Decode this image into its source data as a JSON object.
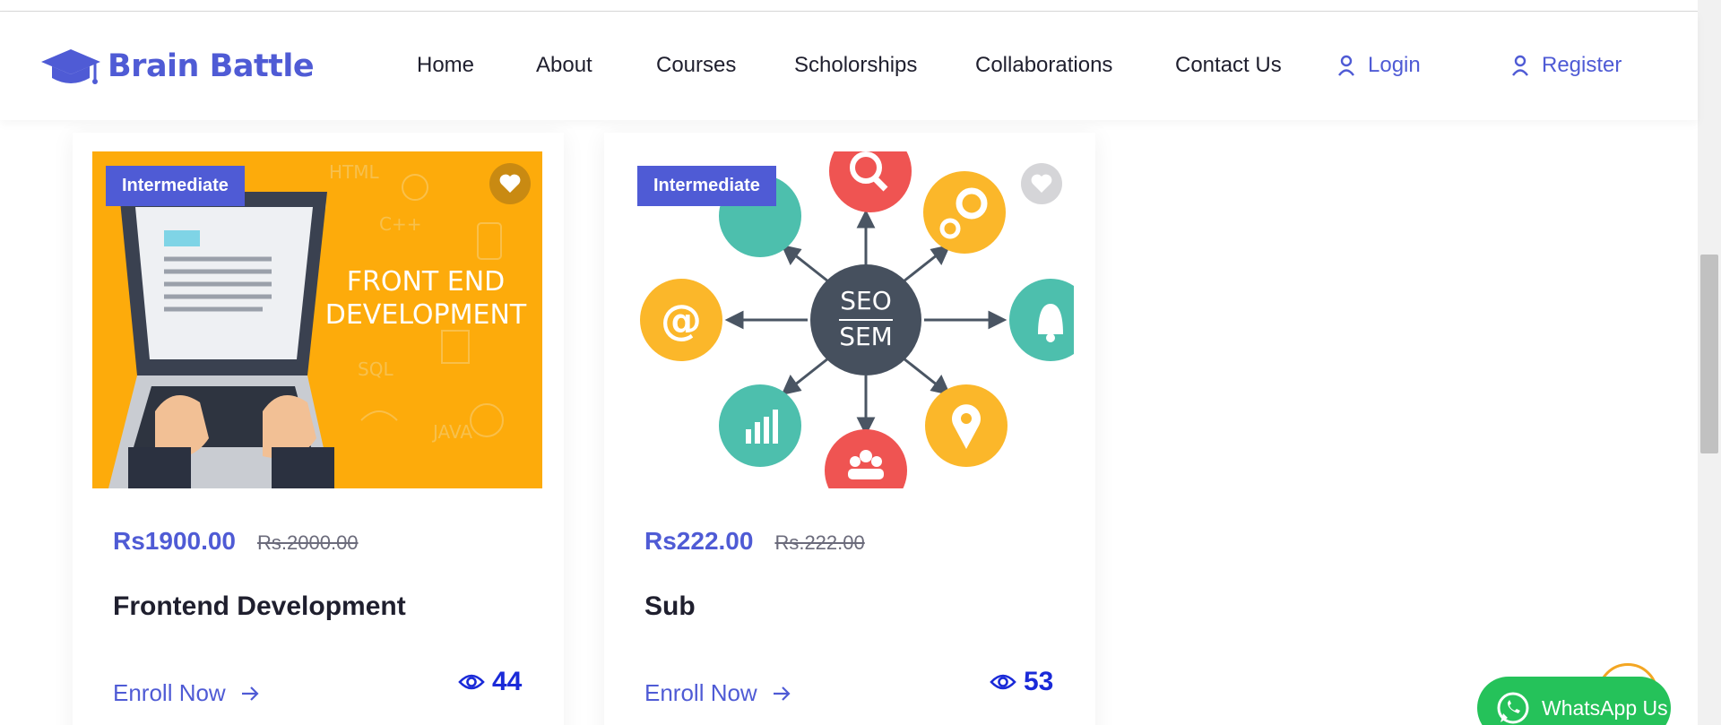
{
  "header": {
    "logo_text": "Brain Battle",
    "nav": [
      "Home",
      "About",
      "Courses",
      "Scholorships",
      "Collaborations",
      "Contact Us"
    ],
    "login": "Login",
    "register": "Register",
    "accent": "#4f5bd5"
  },
  "cards": [
    {
      "badge": "Intermediate",
      "image_text_1": "FRONT END",
      "image_text_2": "DEVELOPMENT",
      "price_now": "Rs1900.00",
      "price_old": "Rs.2000.00",
      "title": "Frontend Development",
      "enroll": "Enroll Now",
      "views": "44",
      "favorited": true
    },
    {
      "badge": "Intermediate",
      "image_text_1": "SEO",
      "image_text_2": "SEM",
      "price_now": "Rs222.00",
      "price_old": "Rs.222.00",
      "title": "Sub",
      "enroll": "Enroll Now",
      "views": "53",
      "favorited": false
    }
  ],
  "whatsapp": {
    "label": "WhatsApp Us",
    "color": "#25c25a"
  }
}
